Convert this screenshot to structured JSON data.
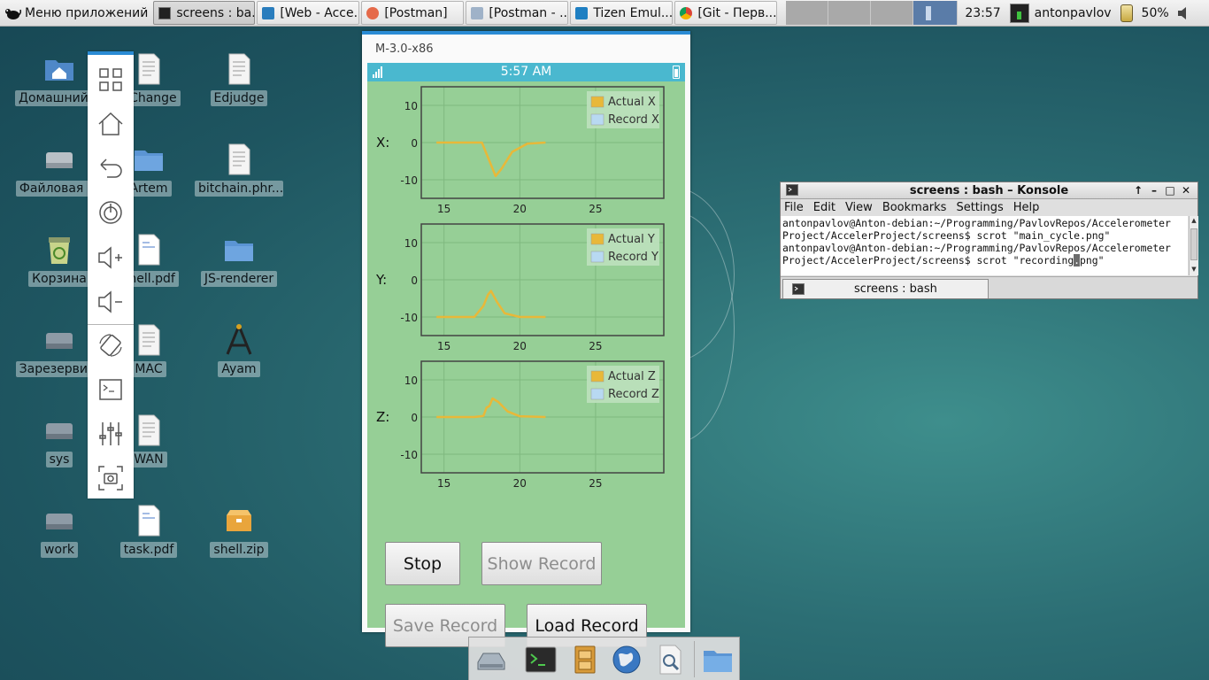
{
  "top_panel": {
    "app_menu_label": "Меню приложений",
    "tasks": [
      {
        "label": "screens : ba...",
        "icon": "terminal-icon",
        "active": true
      },
      {
        "label": "[Web - Acce...",
        "icon": "ide-icon"
      },
      {
        "label": "[Postman]",
        "icon": "postman-icon"
      },
      {
        "label": "[Postman - ...",
        "icon": "folder-icon"
      },
      {
        "label": "Tizen Emul...",
        "icon": "tizen-icon"
      },
      {
        "label": "[Git - Перв...",
        "icon": "chrome-icon"
      }
    ],
    "clock": "23:57",
    "user": "antonpavlov",
    "battery": "50%"
  },
  "desktop_icons": [
    {
      "label": "Домашний ...",
      "icon": "home-folder-icon"
    },
    {
      "label": "Файловая ...",
      "icon": "drive-icon"
    },
    {
      "label": "Корзина",
      "icon": "trash-icon"
    },
    {
      "label": "Зарезерви...",
      "icon": "drive-icon"
    },
    {
      "label": "sys",
      "icon": "drive-icon"
    },
    {
      "label": "work",
      "icon": "drive-icon"
    },
    {
      "label": "CChange",
      "icon": "document-icon"
    },
    {
      "label": "Artem",
      "icon": "folder-icon"
    },
    {
      "label": "shell.pdf",
      "icon": "pdf-icon"
    },
    {
      "label": "MAC",
      "icon": "document-icon"
    },
    {
      "label": "WAN",
      "icon": "document-icon"
    },
    {
      "label": "task.pdf",
      "icon": "pdf-icon"
    },
    {
      "label": "Edjudge",
      "icon": "document-icon"
    },
    {
      "label": "bitchain.phr...",
      "icon": "document-icon"
    },
    {
      "label": "JS-renderer",
      "icon": "folder-icon"
    },
    {
      "label": "Ayam",
      "icon": "compass-icon"
    },
    {
      "label": "shell.zip",
      "icon": "archive-icon"
    }
  ],
  "emulator": {
    "title": "M-3.0-x86",
    "status_time": "5:57 AM",
    "sidebar": [
      "apps-grid-icon",
      "home-icon",
      "back-icon",
      "power-icon",
      "volume-up-icon",
      "volume-down-icon",
      "rotate-icon",
      "shell-icon",
      "settings-icon",
      "screenshot-icon"
    ],
    "charts": [
      {
        "axis": "X:",
        "legend_actual": "Actual X",
        "legend_record": "Record X",
        "x": [
          14.5,
          17.0,
          17.5,
          18.0,
          18.4,
          18.8,
          19.5,
          20.5,
          21.7
        ],
        "y": [
          0,
          0,
          0,
          -5,
          -9,
          -7,
          -2.5,
          -0.3,
          0
        ]
      },
      {
        "axis": "Y:",
        "legend_actual": "Actual Y",
        "legend_record": "Record Y",
        "x": [
          14.5,
          17.0,
          17.6,
          17.9,
          18.1,
          18.5,
          19.0,
          20.0,
          21.7
        ],
        "y": [
          -10,
          -10,
          -7,
          -4,
          -3,
          -6,
          -9,
          -10,
          -10
        ]
      },
      {
        "axis": "Z:",
        "legend_actual": "Actual Z",
        "legend_record": "Record Z",
        "x": [
          14.5,
          17.0,
          17.6,
          17.8,
          18.0,
          18.2,
          18.6,
          19.2,
          20.0,
          21.7
        ],
        "y": [
          0,
          0,
          0.3,
          2.5,
          3,
          5,
          4,
          1.5,
          0.2,
          0
        ]
      }
    ],
    "chart_data": [
      {
        "type": "line",
        "xlim": [
          13.5,
          29.5
        ],
        "ylim": [
          -15,
          15
        ],
        "x_ticks": [
          15,
          20,
          25
        ],
        "y_ticks": [
          10,
          0,
          -10
        ],
        "series": [
          {
            "name": "Actual X",
            "color": "#e8b839",
            "x": [
              14.5,
              17.0,
              17.5,
              18.0,
              18.4,
              18.8,
              19.5,
              20.5,
              21.7
            ],
            "y": [
              0,
              0,
              0,
              -5,
              -9,
              -7,
              -2.5,
              -0.3,
              0
            ]
          },
          {
            "name": "Record X",
            "color": "#b8d9f2",
            "x": [],
            "y": []
          }
        ]
      },
      {
        "type": "line",
        "xlim": [
          13.5,
          29.5
        ],
        "ylim": [
          -15,
          15
        ],
        "x_ticks": [
          15,
          20,
          25
        ],
        "y_ticks": [
          10,
          0,
          -10
        ],
        "series": [
          {
            "name": "Actual Y",
            "color": "#e8b839",
            "x": [
              14.5,
              17.0,
              17.6,
              17.9,
              18.1,
              18.5,
              19.0,
              20.0,
              21.7
            ],
            "y": [
              -10,
              -10,
              -7,
              -4,
              -3,
              -6,
              -9,
              -10,
              -10
            ]
          },
          {
            "name": "Record Y",
            "color": "#b8d9f2",
            "x": [],
            "y": []
          }
        ]
      },
      {
        "type": "line",
        "xlim": [
          13.5,
          29.5
        ],
        "ylim": [
          -15,
          15
        ],
        "x_ticks": [
          15,
          20,
          25
        ],
        "y_ticks": [
          10,
          0,
          -10
        ],
        "series": [
          {
            "name": "Actual Z",
            "color": "#e8b839",
            "x": [
              14.5,
              17.0,
              17.6,
              17.8,
              18.0,
              18.2,
              18.6,
              19.2,
              20.0,
              21.7
            ],
            "y": [
              0,
              0,
              0.3,
              2.5,
              3,
              5,
              4,
              1.5,
              0.2,
              0
            ]
          },
          {
            "name": "Record Z",
            "color": "#b8d9f2",
            "x": [],
            "y": []
          }
        ]
      }
    ],
    "buttons": {
      "stop": "Stop",
      "show_record": "Show Record",
      "save_record": "Save Record",
      "load_record": "Load Record"
    }
  },
  "konsole": {
    "title": "screens : bash – Konsole",
    "menu": [
      "File",
      "Edit",
      "View",
      "Bookmarks",
      "Settings",
      "Help"
    ],
    "lines": [
      "antonpavlov@Anton-debian:~/Programming/PavlovRepos/Accelerometer",
      "Project/AccelerProject/screens$ scrot \"main_cycle.png\"",
      "antonpavlov@Anton-debian:~/Programming/PavlovRepos/Accelerometer"
    ],
    "last_line_before_cursor": "Project/AccelerProject/screens$ scrot \"recording",
    "cursor_char": ".",
    "last_line_after_cursor": "png\"",
    "tab_label": "screens : bash"
  },
  "dock": [
    "drive-icon",
    "terminal-icon",
    "file-cabinet-icon",
    "globe-icon",
    "search-files-icon",
    "folder-icon"
  ]
}
